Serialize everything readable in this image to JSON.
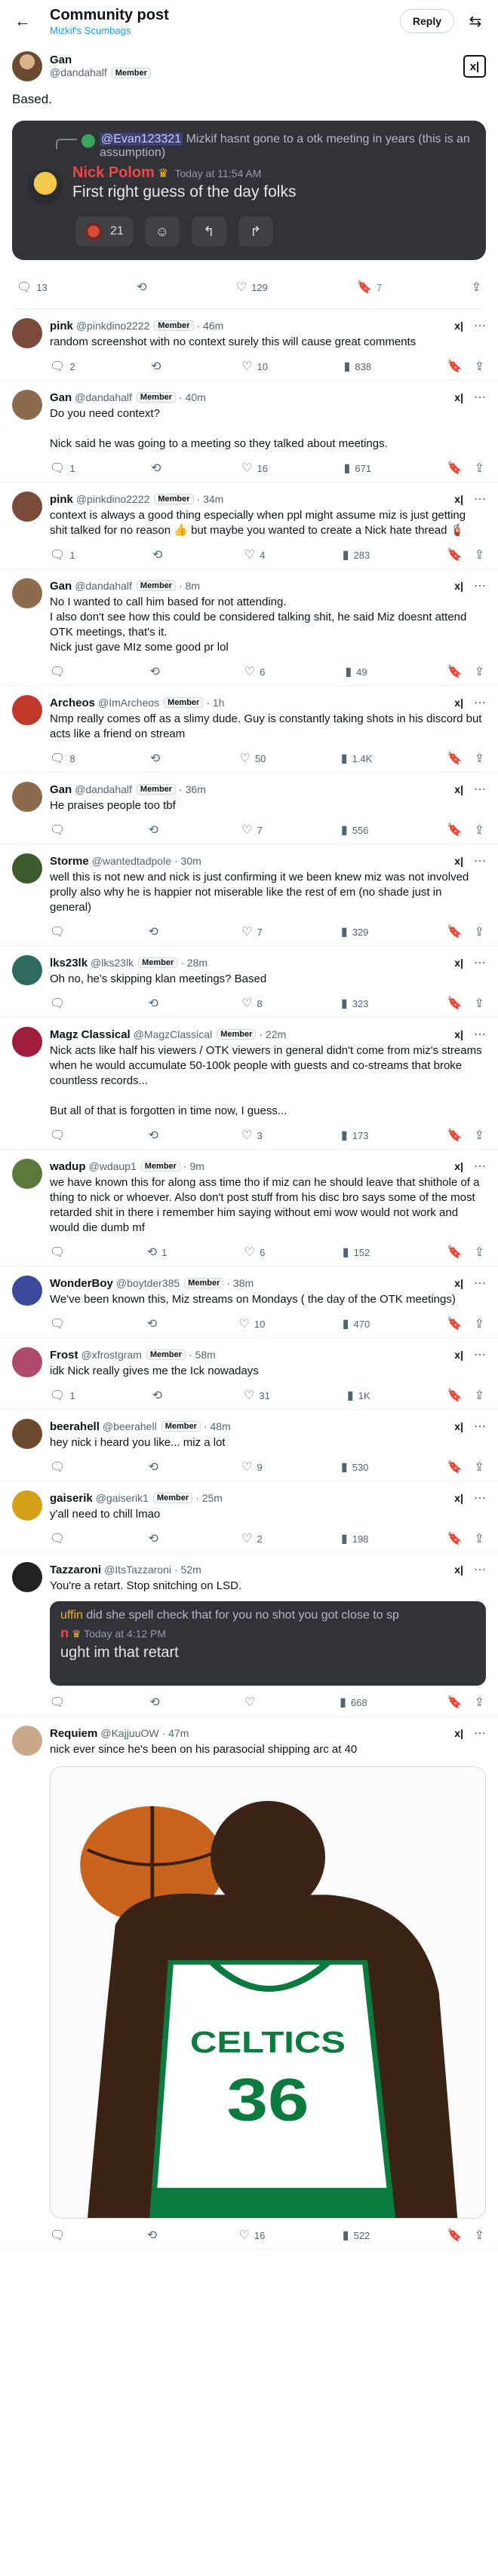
{
  "header": {
    "title": "Community post",
    "community": "Mizkif's Scumbags",
    "reply_label": "Reply"
  },
  "post": {
    "name": "Gan",
    "handle": "@dandahalf",
    "badge": "Member",
    "grok": "x|",
    "text": "Based.",
    "embed": {
      "reply_mention": "@Evan123321",
      "reply_text": "Mizkif hasnt gone to a otk meeting in years (this is an assumption)",
      "author": "Nick Polom",
      "crown": "♛",
      "time": "Today at 11:54 AM",
      "text": "First right guess of the day folks",
      "reaction_count": "21"
    },
    "stats": {
      "replies": "13",
      "likes": "129",
      "bookmarks": "7"
    }
  },
  "replies": [
    {
      "name": "pink",
      "handle": "@pinkdino2222",
      "badge": "Member",
      "time": "· 46m",
      "text": "random screenshot with no context surely this will cause great comments",
      "replies": "2",
      "reposts": "",
      "likes": "10",
      "views": "838",
      "color": "#7a4a3a"
    },
    {
      "name": "Gan",
      "handle": "@dandahalf",
      "badge": "Member",
      "time": "· 40m",
      "text": "Do you need context?\n\nNick said he was going to a meeting so they talked about meetings.",
      "replies": "1",
      "reposts": "",
      "likes": "16",
      "views": "671",
      "color": "#8b6a4d"
    },
    {
      "name": "pink",
      "handle": "@pinkdino2222",
      "badge": "Member",
      "time": "· 34m",
      "text": "context is always a good thing especially when ppl might assume miz is just getting shit talked for no reason 👍 but maybe you wanted to create a Nick hate thread 🧯",
      "replies": "1",
      "reposts": "",
      "likes": "4",
      "views": "283",
      "color": "#7a4a3a"
    },
    {
      "name": "Gan",
      "handle": "@dandahalf",
      "badge": "Member",
      "time": "· 8m",
      "text": "No I wanted to call him based for not attending.\nI also don't see how this could be considered talking shit, he said Miz doesnt attend OTK meetings, that's it.\nNick just gave MIz some good pr lol",
      "replies": "",
      "reposts": "",
      "likes": "6",
      "views": "49",
      "color": "#8b6a4d"
    },
    {
      "name": "Archeos",
      "handle": "@ImArcheos",
      "badge": "Member",
      "time": "· 1h",
      "text": "Nmp really comes off as a slimy dude. Guy is constantly taking shots in his discord but acts like a friend on stream",
      "replies": "8",
      "reposts": "",
      "likes": "50",
      "views": "1.4K",
      "color": "#c0392b"
    },
    {
      "name": "Gan",
      "handle": "@dandahalf",
      "badge": "Member",
      "time": "· 36m",
      "text": "He praises people too tbf",
      "replies": "",
      "reposts": "",
      "likes": "7",
      "views": "556",
      "color": "#8b6a4d"
    },
    {
      "name": "Storme",
      "handle": "@wantedtadpole",
      "badge": "",
      "time": "· 30m",
      "text": "well this is not new and nick is just confirming it we been knew miz was not involved prolly also why he is happier not miserable like the rest of em (no shade just in general)",
      "replies": "",
      "reposts": "",
      "likes": "7",
      "views": "329",
      "color": "#3e5b2e"
    },
    {
      "name": "lks23lk",
      "handle": "@lks23lk",
      "badge": "Member",
      "time": "· 28m",
      "text": "Oh no, he's skipping klan meetings? Based",
      "replies": "",
      "reposts": "",
      "likes": "8",
      "views": "323",
      "color": "#2e6b5e"
    },
    {
      "name": "Magz Classical",
      "handle": "@MagzClassical",
      "badge": "Member",
      "time": "· 22m",
      "text": "Nick acts like half his viewers / OTK viewers in general didn't come from miz's streams when he would accumulate 50-100k people with guests and co-streams that broke countless records...\n\nBut all of that is forgotten in time now, I guess...",
      "replies": "",
      "reposts": "",
      "likes": "3",
      "views": "173",
      "color": "#a01c3c"
    },
    {
      "name": "wadup",
      "handle": "@wdaup1",
      "badge": "Member",
      "time": "· 9m",
      "text": "we have known this for along ass time tho if miz can he should leave that shithole of a thing to nick or whoever. Also don't post stuff from his disc bro says some of the most retarded shit in there i remember him saying without emi wow would not work and would die dumb mf",
      "replies": "",
      "reposts": "1",
      "likes": "6",
      "views": "152",
      "color": "#5b7a3a"
    },
    {
      "name": "WonderBoy",
      "handle": "@boytder385",
      "badge": "Member",
      "time": "· 38m",
      "text": "We've been known this, Miz streams on Mondays ( the day of the OTK meetings)",
      "replies": "",
      "reposts": "",
      "likes": "10",
      "views": "470",
      "color": "#3b4a9a"
    },
    {
      "name": "Frost",
      "handle": "@xfrostgram",
      "badge": "Member",
      "time": "· 58m",
      "text": "idk Nick really gives me the Ick nowadays",
      "replies": "1",
      "reposts": "",
      "likes": "31",
      "views": "1K",
      "color": "#b04a6a"
    },
    {
      "name": "beerahell",
      "handle": "@beerahell",
      "badge": "Member",
      "time": "· 48m",
      "text": "hey nick i heard you like... miz a lot",
      "replies": "",
      "reposts": "",
      "likes": "9",
      "views": "530",
      "color": "#6b4a2e"
    },
    {
      "name": "gaiserik",
      "handle": "@gaiserik1",
      "badge": "Member",
      "time": "· 25m",
      "text": "y'all need to chill lmao",
      "replies": "",
      "reposts": "",
      "likes": "2",
      "views": "198",
      "color": "#d4a017"
    },
    {
      "name": "Tazzaroni",
      "handle": "@ItsTazzaroni",
      "badge": "",
      "time": "· 52m",
      "text": "You're a retart. Stop snitching on LSD.",
      "replies": "",
      "reposts": "",
      "likes": "",
      "views": "668",
      "color": "#222222",
      "crop": {
        "line1": "did she spell check that for you no shot you got close to sp",
        "line1_prefix": "uffin",
        "time": "Today at 4:12 PM",
        "author": "n",
        "text": "ught im that retart"
      }
    },
    {
      "name": "Requiem",
      "handle": "@KajjuuOW",
      "badge": "",
      "time": "· 47m",
      "text": "nick ever since he's been on his parasocial shipping arc at 40",
      "replies": "",
      "reposts": "",
      "likes": "16",
      "views": "522",
      "color": "#c8a888",
      "photo": {
        "team": "CELTICS",
        "number": "36"
      }
    }
  ]
}
